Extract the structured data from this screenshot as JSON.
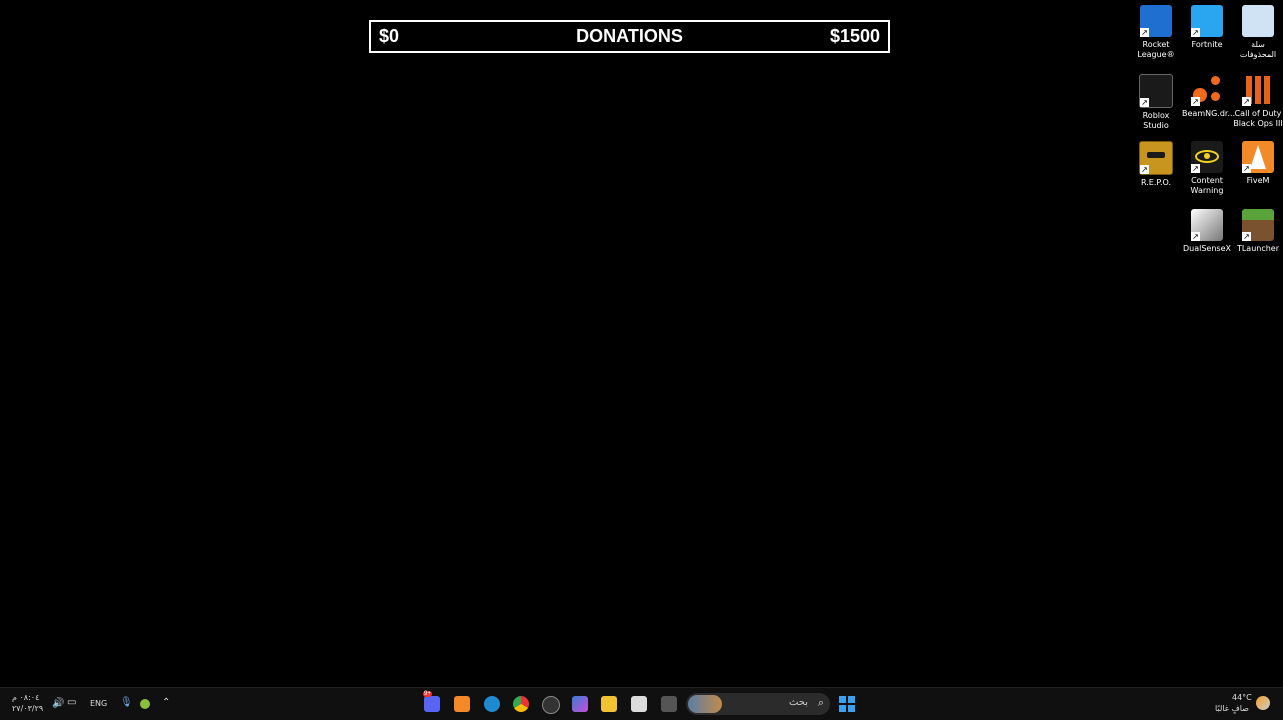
{
  "donation_bar": {
    "min": "$0",
    "title": "DONATIONS",
    "max": "$1500"
  },
  "desktop_icons": [
    {
      "label": "Rocket\nLeague®",
      "color": "#1f6fd1"
    },
    {
      "label": "Fortnite",
      "color": "#2aa6f0"
    },
    {
      "label": "سلة\nالمحذوفات",
      "color": "#cfe3f5"
    },
    {
      "label": "Roblox\nStudio",
      "color": "#1a1a1a"
    },
    {
      "label": "BeamNG.dr...",
      "color": "#f26a1b"
    },
    {
      "label": "Call of Duty\nBlack Ops III",
      "color": "#e8631a"
    },
    {
      "label": "R.E.P.O.",
      "color": "#c8951e"
    },
    {
      "label": "Content\nWarning",
      "color": "#1a1a1a"
    },
    {
      "label": "FiveM",
      "color": "#f28a2a"
    },
    {
      "label": "DualSenseX",
      "color": "#dddddd"
    },
    {
      "label": "TLauncher",
      "color": "#4c8a2c"
    }
  ],
  "taskbar": {
    "search_placeholder": "بحث",
    "badge": "9+",
    "language": "ENG",
    "time": "٠٨:٠٤ م",
    "date": "٢٧/٠٣/٢٩",
    "weather_temp": "44°C",
    "weather_desc": "صافٍ غالبًا"
  }
}
